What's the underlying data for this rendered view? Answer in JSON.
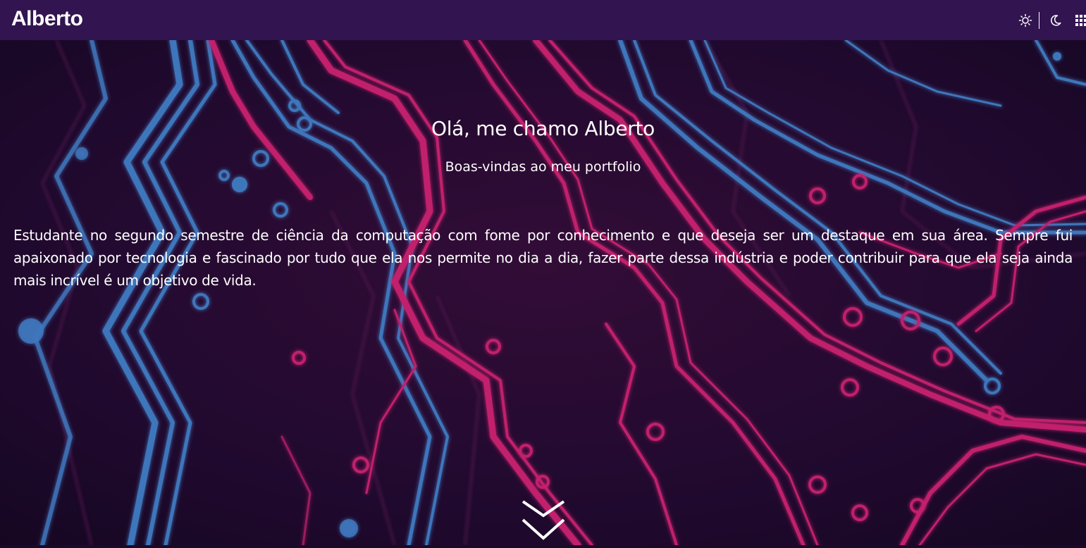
{
  "navbar": {
    "brand": "Alberto",
    "icons": [
      "sun-icon",
      "moon-icon",
      "grid-menu-icon"
    ]
  },
  "hero": {
    "title": "Olá, me chamo Alberto",
    "subtitle": "Boas-vindas ao meu portfolio",
    "paragraph": "Estudante no segundo semestre de ciência da computação com fome por conhecimento e que deseja ser um destaque em sua área. Sempre fui apaixonado por tecnologia e fascinado por tudo que ela nos permite no dia a dia, fazer parte dessa indústria e poder contribuir para que ela seja ainda mais incrível é um objetivo de vida.",
    "scroll_icon": "double-chevron-down-icon"
  },
  "colors": {
    "navbar_bg": "#321450",
    "background_dark": "#1a0a2a",
    "circuit_pink": "#e8257f",
    "circuit_blue": "#4a8fe0",
    "text": "#ffffff"
  }
}
